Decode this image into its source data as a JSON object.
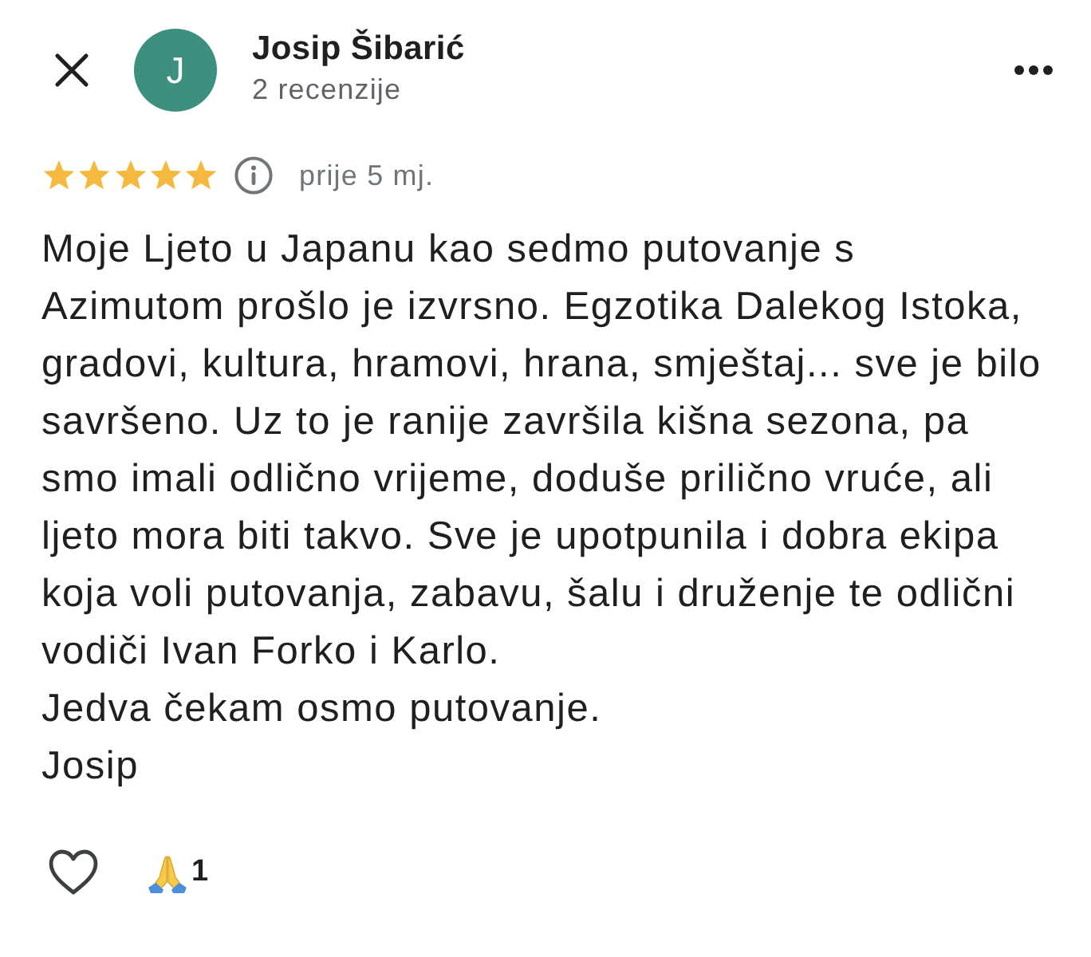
{
  "reviewer": {
    "initial": "J",
    "name": "Josip Šibarić",
    "reviews": "2 recenzije"
  },
  "review": {
    "stars": 5,
    "time": "prije 5 mj.",
    "paragraphs": [
      "Moje Ljeto u Japanu kao sedmo putovanje s\nAzimutom prošlo je izvrsno. Egzotika Dalekog Istoka,\ngradovi, kultura, hramovi, hrana, smještaj... sve je bilo\nsavršeno. Uz to je ranije završila kišna sezona, pa\nsmo imali odlično vrijeme, doduše prilično vruće, ali\nljeto mora biti takvo. Sve je upotpunila i dobra ekipa\nkoja voli putovanja, zabavu, šalu i druženje te odlični\nvodiči Ivan Forko i Karlo.",
      "Jedva čekam osmo putovanje.",
      "Josip"
    ]
  },
  "footer": {
    "liked": false,
    "reactions": [
      {
        "kind": "pray",
        "count": "1"
      }
    ]
  }
}
